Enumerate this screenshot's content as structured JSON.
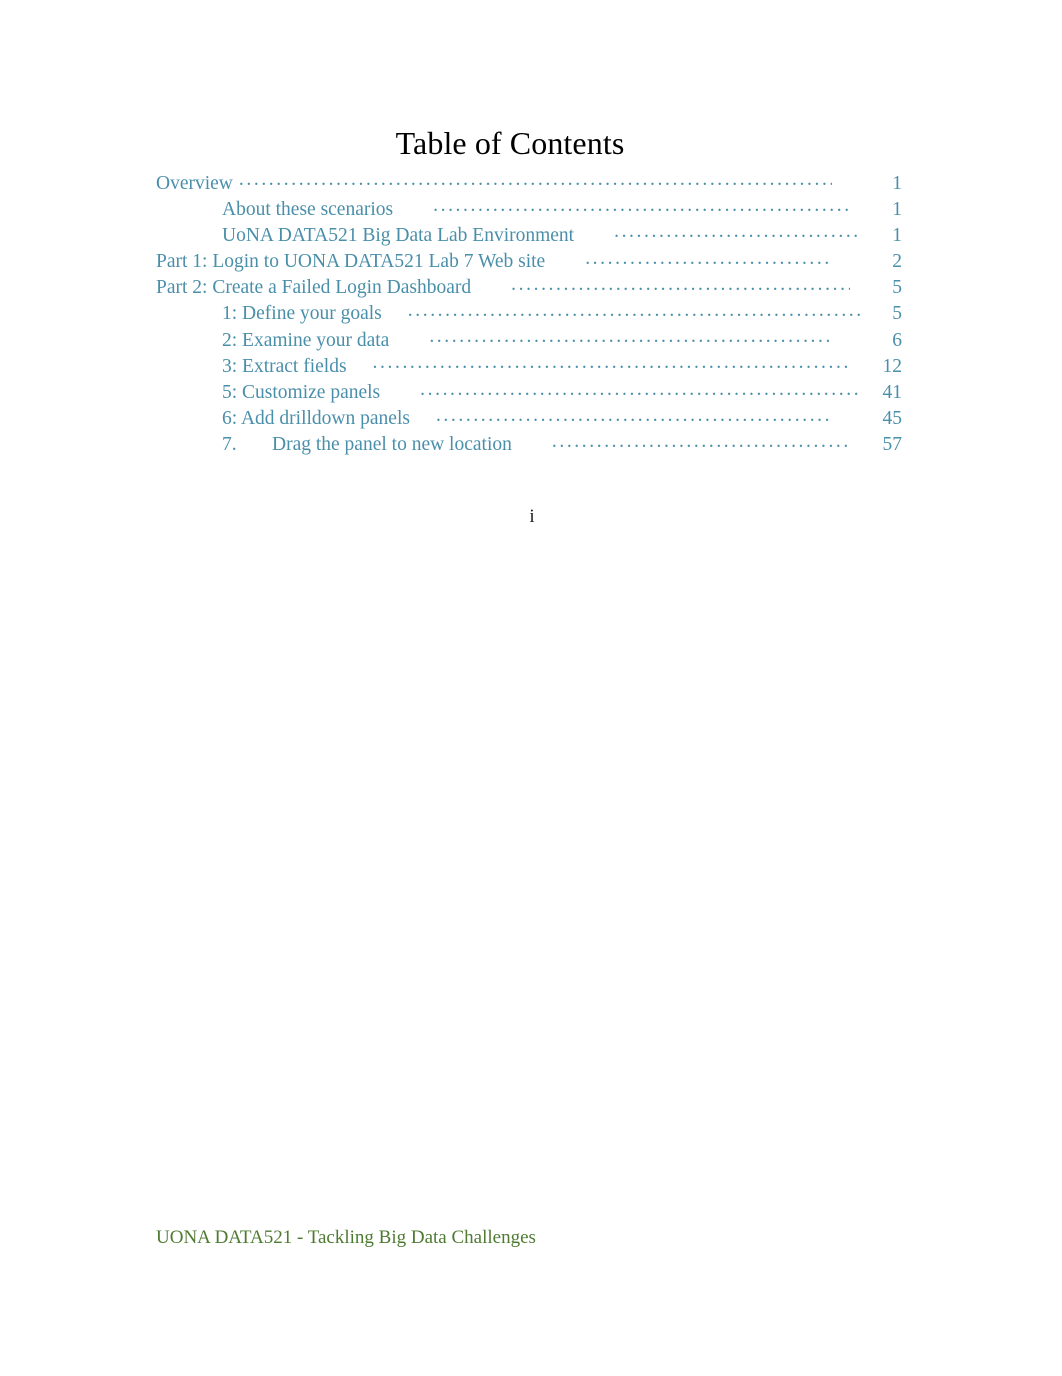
{
  "document": {
    "title": "Table of Contents",
    "page_marker": "i",
    "footer": "UONA DATA521 - Tackling Big Data Challenges",
    "colors": {
      "title": "#000000",
      "entry": "#4a8faa",
      "footer": "#4e7a32",
      "background": "#ffffff"
    }
  },
  "toc": {
    "entries": [
      {
        "prefix": "",
        "label": "Overview",
        "page": "1",
        "level": 1,
        "gap": "none"
      },
      {
        "prefix": "",
        "label": "About these scenarios",
        "page": "1",
        "level": 2,
        "gap": "med"
      },
      {
        "prefix": "",
        "label": "UoNA DATA521 Big Data Lab Environment",
        "page": "1",
        "level": 2,
        "gap": "med"
      },
      {
        "prefix": "",
        "label": "Part 1: Login to UONA DATA521 Lab 7 Web site",
        "page": "2",
        "level": 1,
        "gap": "med"
      },
      {
        "prefix": "",
        "label": "Part 2: Create a Failed Login Dashboard",
        "page": "5",
        "level": 1,
        "gap": "med"
      },
      {
        "prefix": "",
        "label": "1: Define your goals",
        "page": "5",
        "level": 2,
        "gap": "small"
      },
      {
        "prefix": "",
        "label": "2: Examine your data",
        "page": "6",
        "level": 2,
        "gap": "med"
      },
      {
        "prefix": "",
        "label": "3: Extract fields",
        "page": "12",
        "level": 2,
        "gap": "small"
      },
      {
        "prefix": "",
        "label": "5: Customize panels",
        "page": "41",
        "level": 2,
        "gap": "med"
      },
      {
        "prefix": "",
        "label": "6: Add drilldown panels",
        "page": "45",
        "level": 2,
        "gap": "small"
      },
      {
        "prefix": "7.",
        "label": "Drag the panel to new location",
        "page": "57",
        "level": 2,
        "gap": "med"
      }
    ]
  }
}
